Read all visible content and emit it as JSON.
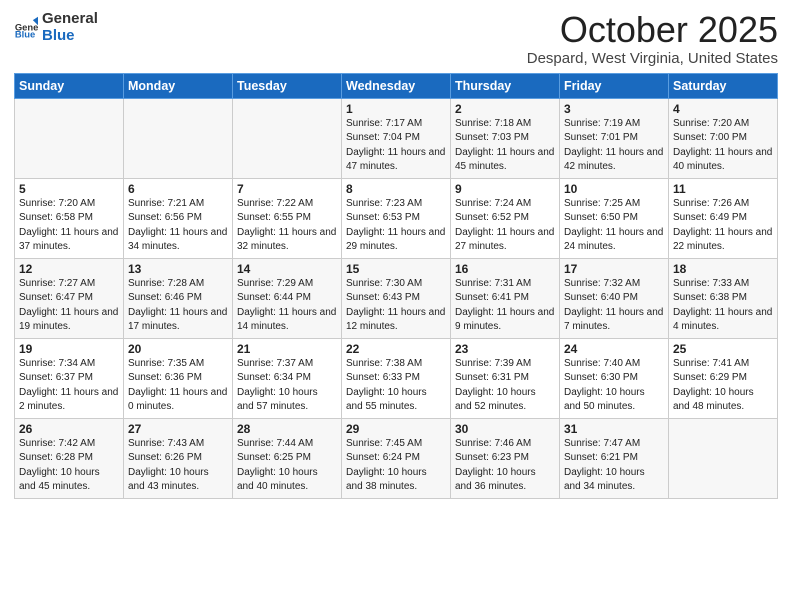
{
  "header": {
    "logo_general": "General",
    "logo_blue": "Blue",
    "month": "October 2025",
    "location": "Despard, West Virginia, United States"
  },
  "weekdays": [
    "Sunday",
    "Monday",
    "Tuesday",
    "Wednesday",
    "Thursday",
    "Friday",
    "Saturday"
  ],
  "weeks": [
    [
      {
        "day": "",
        "sunrise": "",
        "sunset": "",
        "daylight": ""
      },
      {
        "day": "",
        "sunrise": "",
        "sunset": "",
        "daylight": ""
      },
      {
        "day": "",
        "sunrise": "",
        "sunset": "",
        "daylight": ""
      },
      {
        "day": "1",
        "sunrise": "Sunrise: 7:17 AM",
        "sunset": "Sunset: 7:04 PM",
        "daylight": "Daylight: 11 hours and 47 minutes."
      },
      {
        "day": "2",
        "sunrise": "Sunrise: 7:18 AM",
        "sunset": "Sunset: 7:03 PM",
        "daylight": "Daylight: 11 hours and 45 minutes."
      },
      {
        "day": "3",
        "sunrise": "Sunrise: 7:19 AM",
        "sunset": "Sunset: 7:01 PM",
        "daylight": "Daylight: 11 hours and 42 minutes."
      },
      {
        "day": "4",
        "sunrise": "Sunrise: 7:20 AM",
        "sunset": "Sunset: 7:00 PM",
        "daylight": "Daylight: 11 hours and 40 minutes."
      }
    ],
    [
      {
        "day": "5",
        "sunrise": "Sunrise: 7:20 AM",
        "sunset": "Sunset: 6:58 PM",
        "daylight": "Daylight: 11 hours and 37 minutes."
      },
      {
        "day": "6",
        "sunrise": "Sunrise: 7:21 AM",
        "sunset": "Sunset: 6:56 PM",
        "daylight": "Daylight: 11 hours and 34 minutes."
      },
      {
        "day": "7",
        "sunrise": "Sunrise: 7:22 AM",
        "sunset": "Sunset: 6:55 PM",
        "daylight": "Daylight: 11 hours and 32 minutes."
      },
      {
        "day": "8",
        "sunrise": "Sunrise: 7:23 AM",
        "sunset": "Sunset: 6:53 PM",
        "daylight": "Daylight: 11 hours and 29 minutes."
      },
      {
        "day": "9",
        "sunrise": "Sunrise: 7:24 AM",
        "sunset": "Sunset: 6:52 PM",
        "daylight": "Daylight: 11 hours and 27 minutes."
      },
      {
        "day": "10",
        "sunrise": "Sunrise: 7:25 AM",
        "sunset": "Sunset: 6:50 PM",
        "daylight": "Daylight: 11 hours and 24 minutes."
      },
      {
        "day": "11",
        "sunrise": "Sunrise: 7:26 AM",
        "sunset": "Sunset: 6:49 PM",
        "daylight": "Daylight: 11 hours and 22 minutes."
      }
    ],
    [
      {
        "day": "12",
        "sunrise": "Sunrise: 7:27 AM",
        "sunset": "Sunset: 6:47 PM",
        "daylight": "Daylight: 11 hours and 19 minutes."
      },
      {
        "day": "13",
        "sunrise": "Sunrise: 7:28 AM",
        "sunset": "Sunset: 6:46 PM",
        "daylight": "Daylight: 11 hours and 17 minutes."
      },
      {
        "day": "14",
        "sunrise": "Sunrise: 7:29 AM",
        "sunset": "Sunset: 6:44 PM",
        "daylight": "Daylight: 11 hours and 14 minutes."
      },
      {
        "day": "15",
        "sunrise": "Sunrise: 7:30 AM",
        "sunset": "Sunset: 6:43 PM",
        "daylight": "Daylight: 11 hours and 12 minutes."
      },
      {
        "day": "16",
        "sunrise": "Sunrise: 7:31 AM",
        "sunset": "Sunset: 6:41 PM",
        "daylight": "Daylight: 11 hours and 9 minutes."
      },
      {
        "day": "17",
        "sunrise": "Sunrise: 7:32 AM",
        "sunset": "Sunset: 6:40 PM",
        "daylight": "Daylight: 11 hours and 7 minutes."
      },
      {
        "day": "18",
        "sunrise": "Sunrise: 7:33 AM",
        "sunset": "Sunset: 6:38 PM",
        "daylight": "Daylight: 11 hours and 4 minutes."
      }
    ],
    [
      {
        "day": "19",
        "sunrise": "Sunrise: 7:34 AM",
        "sunset": "Sunset: 6:37 PM",
        "daylight": "Daylight: 11 hours and 2 minutes."
      },
      {
        "day": "20",
        "sunrise": "Sunrise: 7:35 AM",
        "sunset": "Sunset: 6:36 PM",
        "daylight": "Daylight: 11 hours and 0 minutes."
      },
      {
        "day": "21",
        "sunrise": "Sunrise: 7:37 AM",
        "sunset": "Sunset: 6:34 PM",
        "daylight": "Daylight: 10 hours and 57 minutes."
      },
      {
        "day": "22",
        "sunrise": "Sunrise: 7:38 AM",
        "sunset": "Sunset: 6:33 PM",
        "daylight": "Daylight: 10 hours and 55 minutes."
      },
      {
        "day": "23",
        "sunrise": "Sunrise: 7:39 AM",
        "sunset": "Sunset: 6:31 PM",
        "daylight": "Daylight: 10 hours and 52 minutes."
      },
      {
        "day": "24",
        "sunrise": "Sunrise: 7:40 AM",
        "sunset": "Sunset: 6:30 PM",
        "daylight": "Daylight: 10 hours and 50 minutes."
      },
      {
        "day": "25",
        "sunrise": "Sunrise: 7:41 AM",
        "sunset": "Sunset: 6:29 PM",
        "daylight": "Daylight: 10 hours and 48 minutes."
      }
    ],
    [
      {
        "day": "26",
        "sunrise": "Sunrise: 7:42 AM",
        "sunset": "Sunset: 6:28 PM",
        "daylight": "Daylight: 10 hours and 45 minutes."
      },
      {
        "day": "27",
        "sunrise": "Sunrise: 7:43 AM",
        "sunset": "Sunset: 6:26 PM",
        "daylight": "Daylight: 10 hours and 43 minutes."
      },
      {
        "day": "28",
        "sunrise": "Sunrise: 7:44 AM",
        "sunset": "Sunset: 6:25 PM",
        "daylight": "Daylight: 10 hours and 40 minutes."
      },
      {
        "day": "29",
        "sunrise": "Sunrise: 7:45 AM",
        "sunset": "Sunset: 6:24 PM",
        "daylight": "Daylight: 10 hours and 38 minutes."
      },
      {
        "day": "30",
        "sunrise": "Sunrise: 7:46 AM",
        "sunset": "Sunset: 6:23 PM",
        "daylight": "Daylight: 10 hours and 36 minutes."
      },
      {
        "day": "31",
        "sunrise": "Sunrise: 7:47 AM",
        "sunset": "Sunset: 6:21 PM",
        "daylight": "Daylight: 10 hours and 34 minutes."
      },
      {
        "day": "",
        "sunrise": "",
        "sunset": "",
        "daylight": ""
      }
    ]
  ]
}
